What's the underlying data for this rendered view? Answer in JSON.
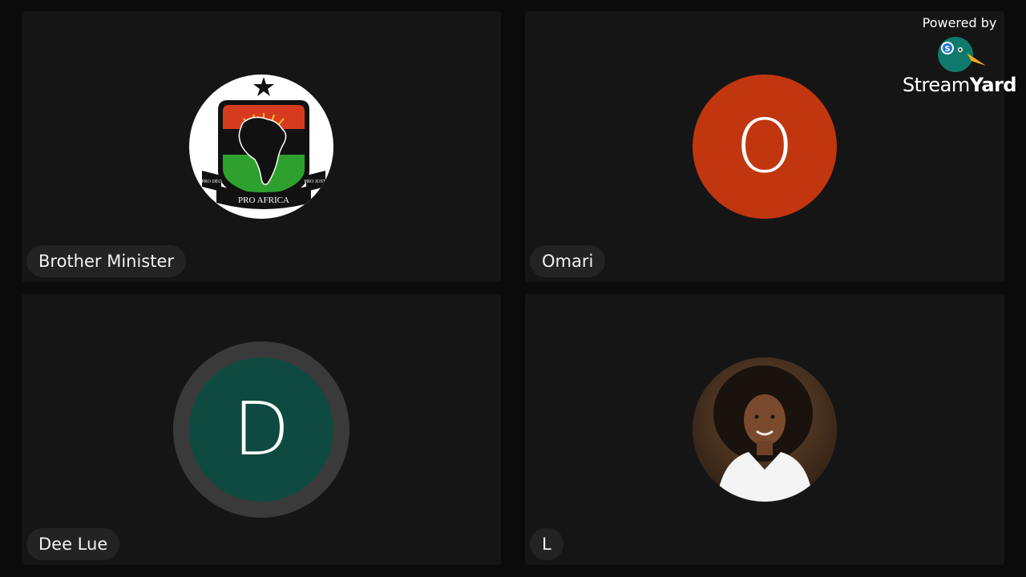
{
  "participants": [
    {
      "name": "Brother Minister",
      "avatar_type": "logo",
      "logo_text": "PRO AFRICA",
      "logo_motto_left": "PRO DEO",
      "logo_motto_right": "PRO JUSTI"
    },
    {
      "name": "Omari",
      "avatar_type": "initial",
      "initial": "O",
      "color": "#c1360f"
    },
    {
      "name": "Dee Lue",
      "avatar_type": "initial",
      "initial": "D",
      "color": "#0e4a3f",
      "speaking": true
    },
    {
      "name": "L",
      "avatar_type": "photo"
    }
  ],
  "branding": {
    "powered_by": "Powered by",
    "logo_name_regular": "Stream",
    "logo_name_bold": "Yard"
  },
  "colors": {
    "background": "#0b0b0b",
    "tile": "#151515",
    "name_tag": "#232323"
  }
}
